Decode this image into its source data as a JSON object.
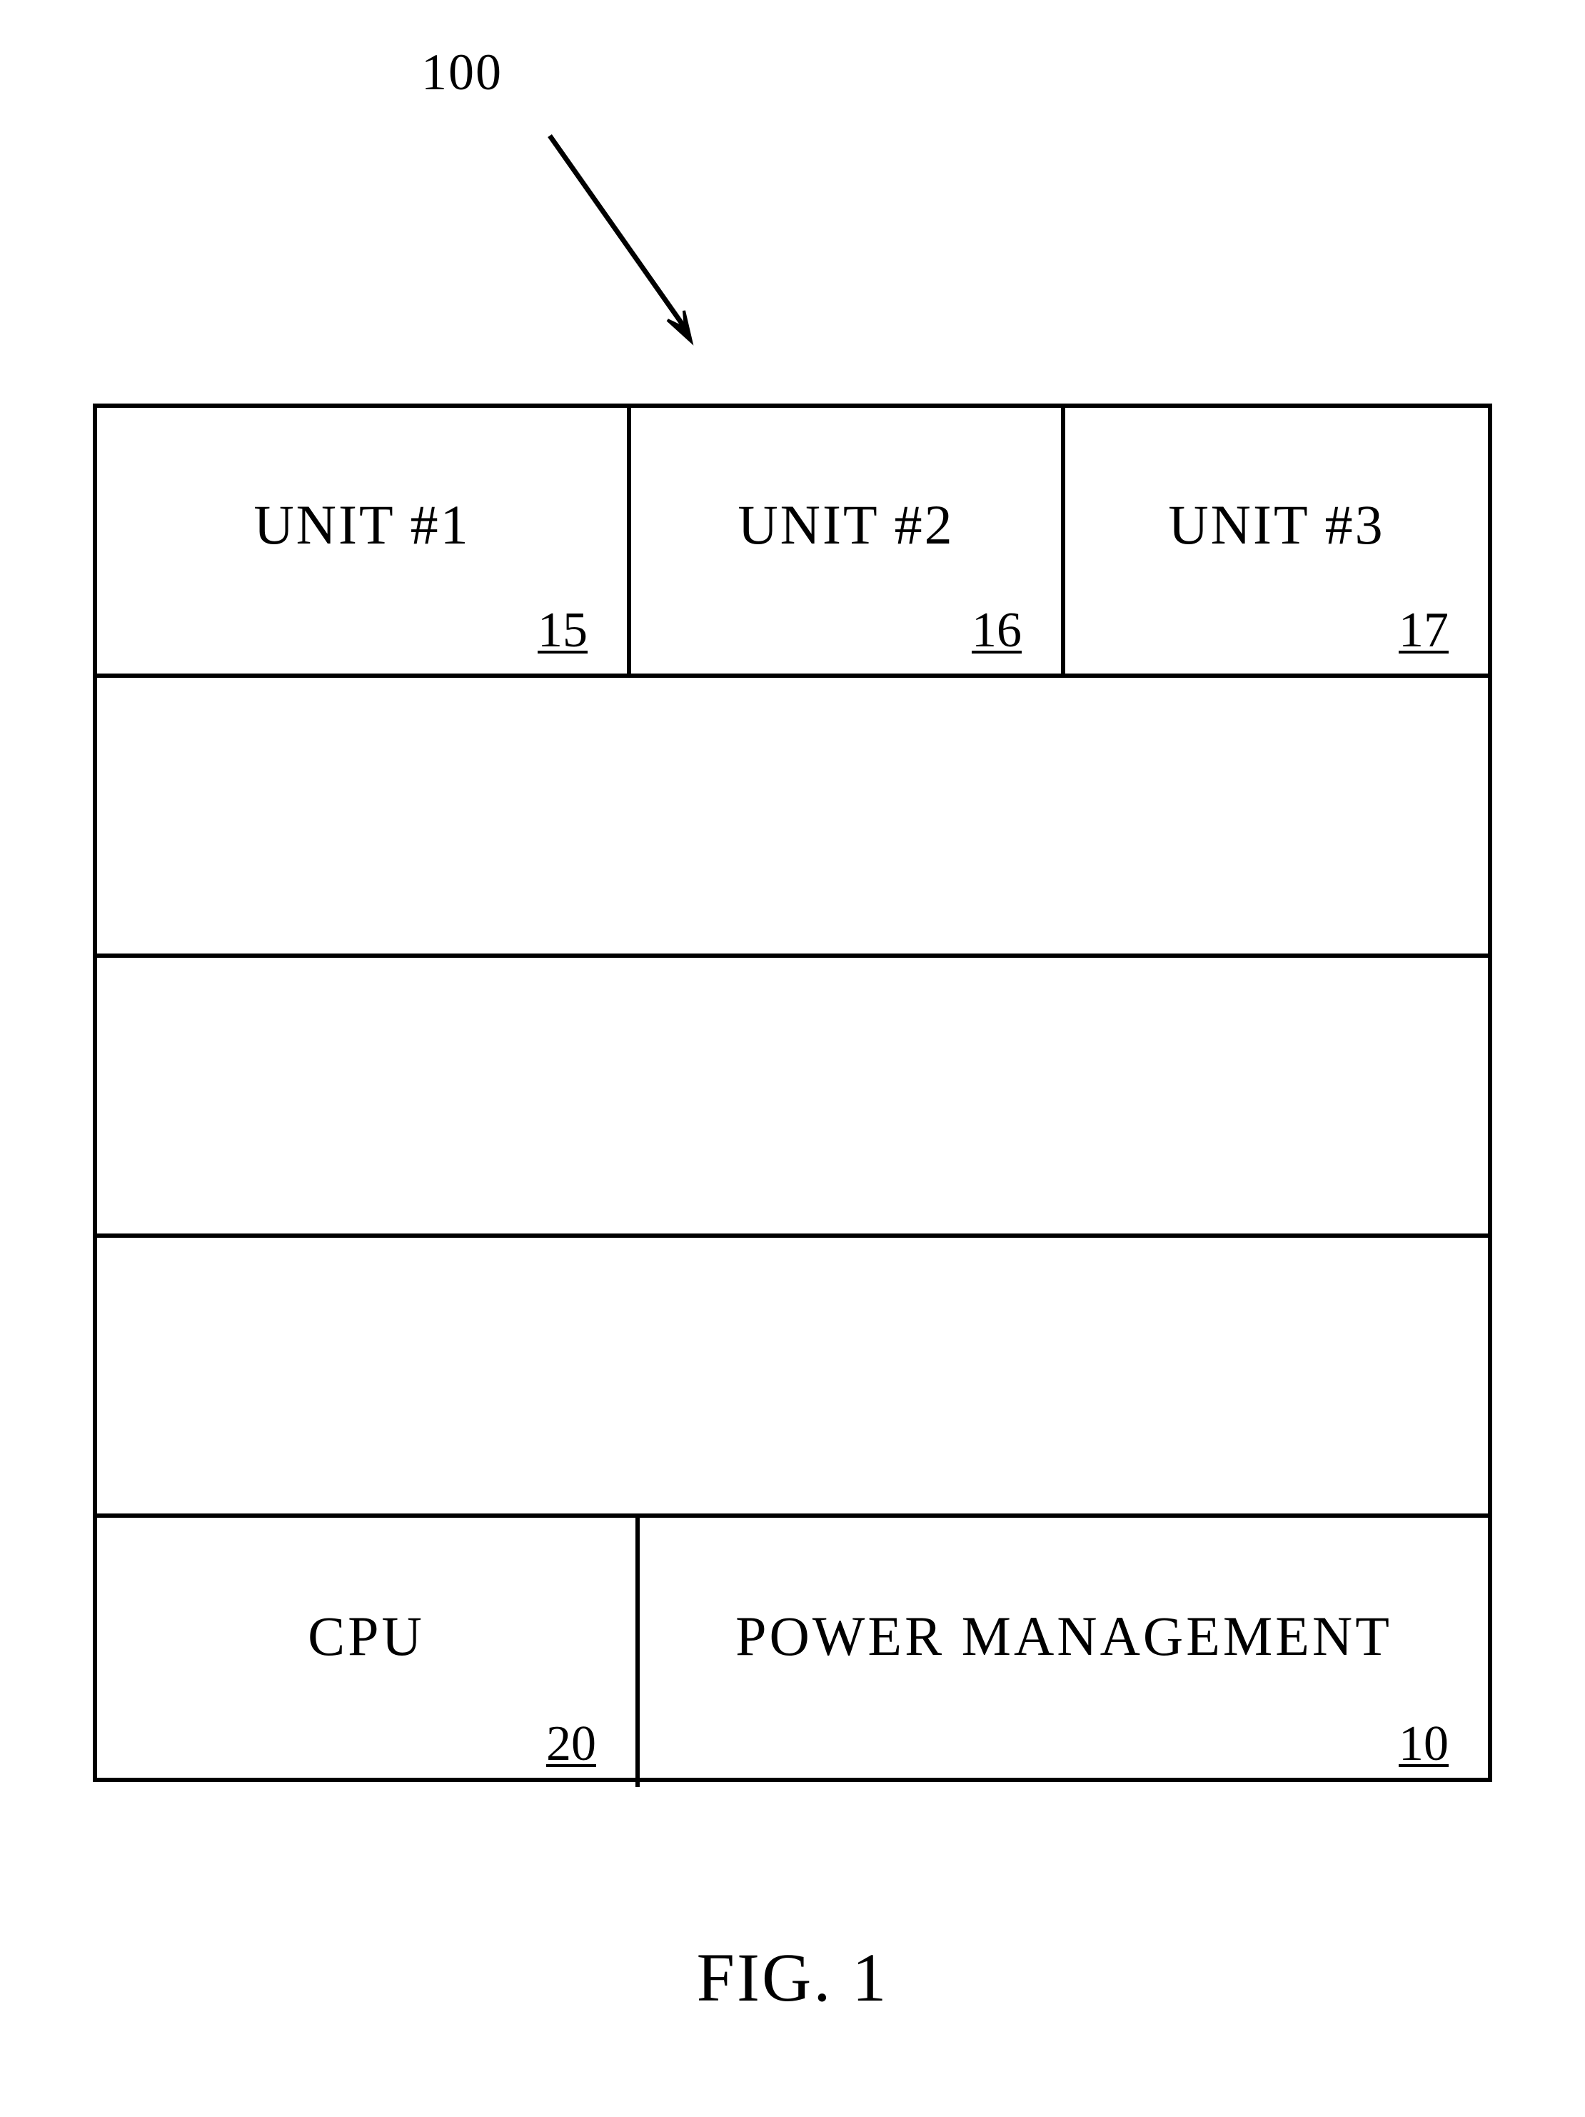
{
  "diagram": {
    "reference_number": "100",
    "figure_label": "FIG. 1",
    "top_units": [
      {
        "label": "UNIT #1",
        "ref": "15"
      },
      {
        "label": "UNIT #2",
        "ref": "16"
      },
      {
        "label": "UNIT #3",
        "ref": "17"
      }
    ],
    "bottom_blocks": {
      "cpu": {
        "label": "CPU",
        "ref": "20"
      },
      "power_mgmt": {
        "label": "POWER MANAGEMENT",
        "ref": "10"
      }
    }
  }
}
